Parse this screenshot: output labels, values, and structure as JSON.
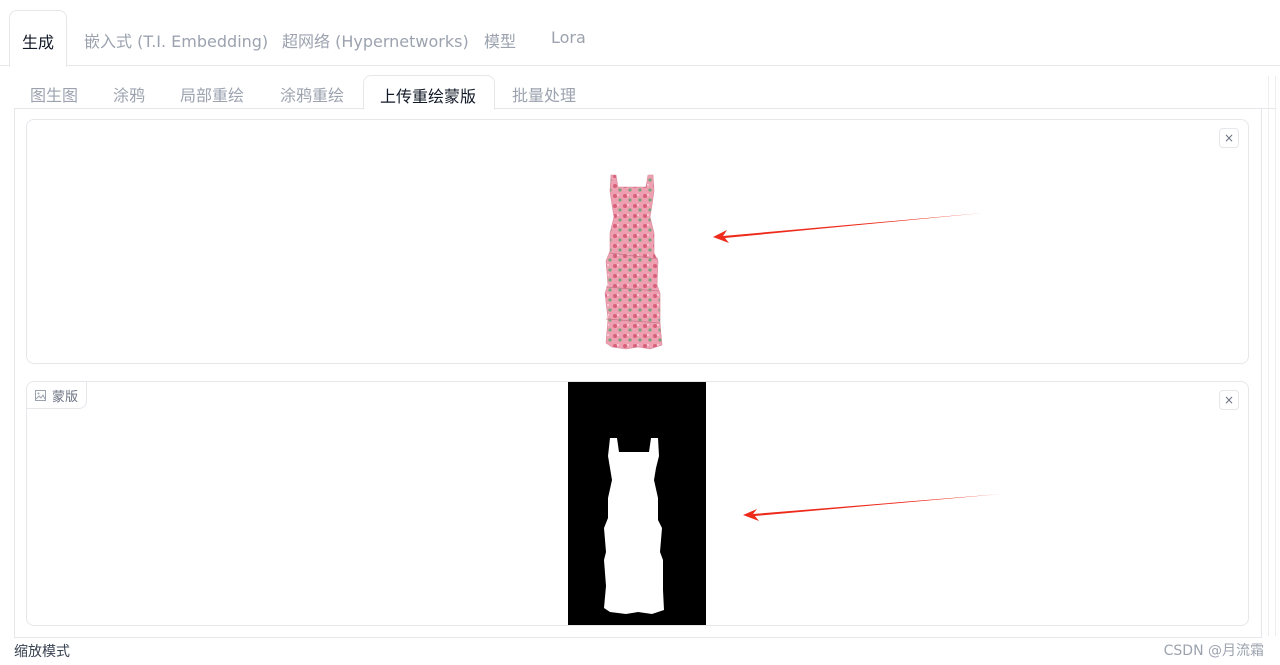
{
  "top_tabs": [
    "生成",
    "嵌入式 (T.I. Embedding)",
    "超网络 (Hypernetworks)",
    "模型",
    "Lora"
  ],
  "sub_tabs": [
    "图生图",
    "涂鸦",
    "局部重绘",
    "涂鸦重绘",
    "上传重绘蒙版",
    "批量处理"
  ],
  "active_top_tab": "生成",
  "active_sub_tab": "上传重绘蒙版",
  "image_panel": {
    "clear_label": "×"
  },
  "mask_panel": {
    "label": "蒙版",
    "clear_label": "×"
  },
  "bottom": {
    "resize_mode_label": "缩放模式"
  },
  "watermark": "CSDN @月流霜",
  "colors": {
    "arrow": "#ee2a1a",
    "mask_bg": "#000000",
    "dress_pink": "#e58aa0"
  }
}
